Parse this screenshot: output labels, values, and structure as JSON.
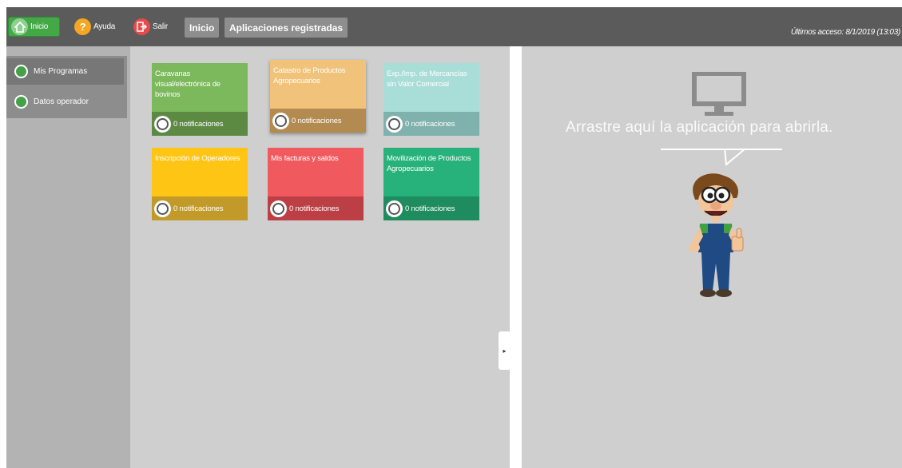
{
  "topbar": {
    "buttons": [
      {
        "label": "Inicio",
        "icon": "home-icon",
        "active": true
      },
      {
        "label": "Ayuda",
        "icon": "help-icon"
      },
      {
        "label": "Salir",
        "icon": "exit-icon"
      }
    ],
    "breadcrumbs": [
      "Inicio",
      "Aplicaciones registradas"
    ],
    "last_access": "Últimos acceso: 8/1/2019 (13:03)"
  },
  "sidebar": {
    "items": [
      {
        "label": "Mis Programas",
        "icon": "programs-icon",
        "selected": true
      },
      {
        "label": "Datos operador",
        "icon": "user-icon"
      }
    ]
  },
  "apps": [
    {
      "name": "Caravanas visual/electrónica de bovinos",
      "notifications": "0 notificaciones",
      "color": "#7cb85c",
      "footer_color": "#5c8a43"
    },
    {
      "name": "Catastro de Productos Agropecuarios",
      "notifications": "0 notificaciones",
      "color": "#f1c27a",
      "footer_color": "#b38a4f"
    },
    {
      "name": "Exp./Imp. de Mercancías sin Valor Comercial",
      "notifications": "0 notificaciones",
      "color": "#a9ddd8",
      "footer_color": "#7fb1ad"
    },
    {
      "name": "Inscripción de Operadores",
      "notifications": "0 notificaciones",
      "color": "#ffc515",
      "footer_color": "#c29a2a"
    },
    {
      "name": "Mis facturas y saldos",
      "notifications": "0 notificaciones",
      "color": "#f05a5f",
      "footer_color": "#bb3f44"
    },
    {
      "name": "Movilización de Productos Agropecuarios",
      "notifications": "0 notificaciones",
      "color": "#28b27b",
      "footer_color": "#1e8c5f"
    }
  ],
  "drop_area": {
    "message": "Arrastre aquí la aplicación para abrirla.",
    "icons": [
      "monitor-icon",
      "mascot-illustration"
    ]
  },
  "colors": {
    "topbar": "#5b5b5b",
    "active_button": "#43a845",
    "sidebar": "#b3b3b3",
    "panel": "#cfcfcf"
  }
}
